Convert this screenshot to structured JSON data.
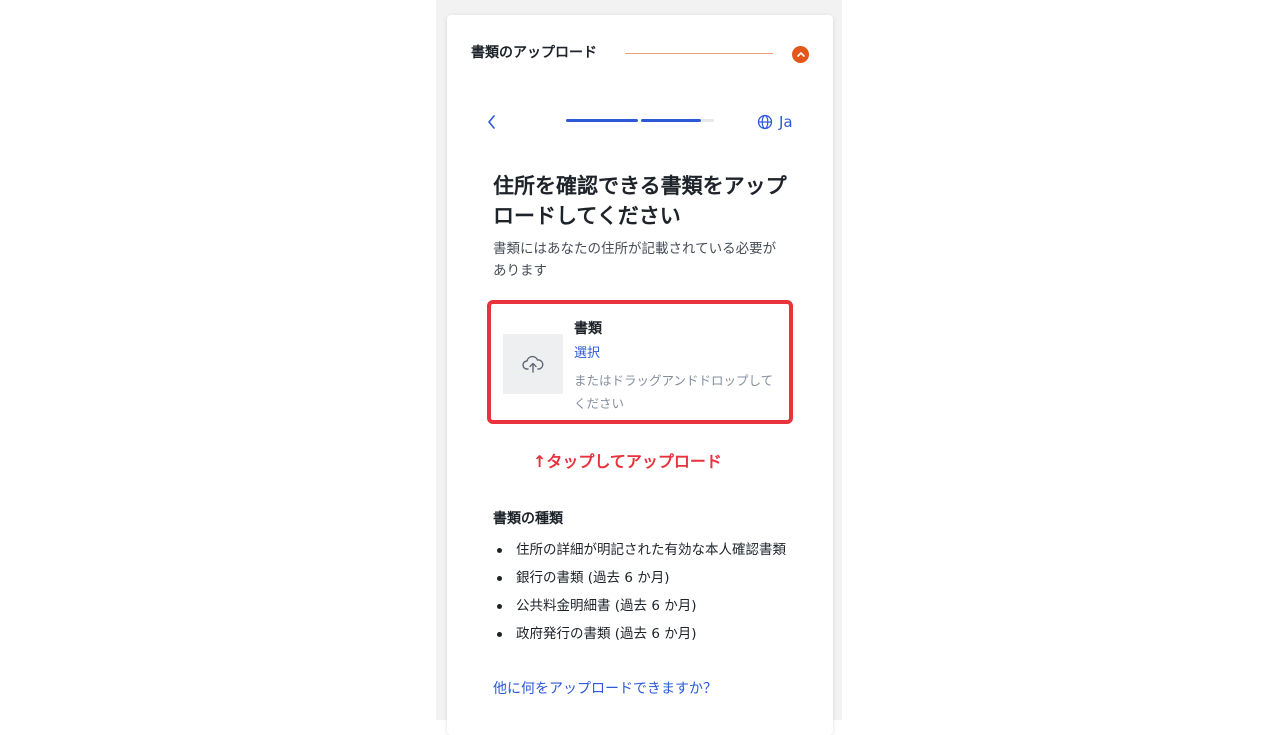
{
  "header": {
    "title": "書類のアップロード"
  },
  "nav": {
    "back_icon": "chevron-left-icon",
    "language_label": "Ja",
    "language_icon": "globe-icon",
    "progress_steps_completed": 2,
    "progress_steps_total": 3
  },
  "page": {
    "title": "住所を確認できる書類をアップロードしてください",
    "subtitle": "書類にはあなたの住所が記載されている必要があります"
  },
  "upload": {
    "icon": "cloud-upload-icon",
    "label": "書類",
    "select_label": "選択",
    "hint": "またはドラッグアンドドロップしてください"
  },
  "annotation": {
    "tap_note": "↑タップしてアップロード"
  },
  "document_types": {
    "heading": "書類の種類",
    "items": [
      "住所の詳細が明記された有効な本人確認書類",
      "銀行の書類 (過去 6 か月)",
      "公共料金明細書 (過去 6 か月)",
      "政府発行の書類 (過去 6 か月)"
    ],
    "more_link": "他に何をアップロードできますか？"
  },
  "colors": {
    "accent_blue": "#2b59d9",
    "brand_orange": "#e4571b",
    "highlight_red": "#e8323c",
    "progress_track": "#e6e8ea"
  }
}
